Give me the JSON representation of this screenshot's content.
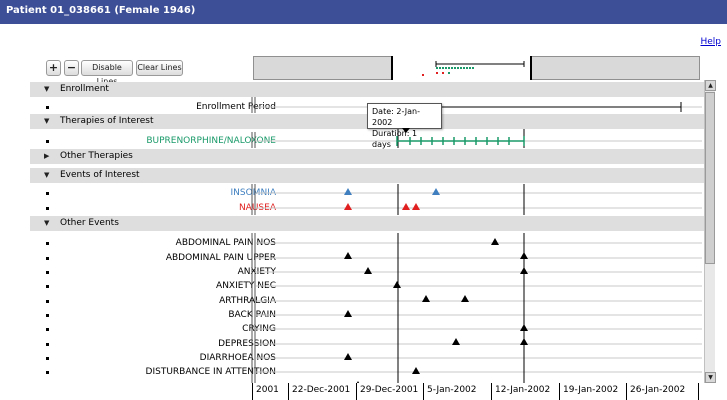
{
  "window": {
    "title": "Patient 01_038661 (Female 1946)"
  },
  "help_label": "Help",
  "toolbar": {
    "zoom_in_label": "+",
    "zoom_out_label": "−",
    "disable_lines_label": "Disable Lines",
    "clear_lines_label": "Clear Lines"
  },
  "tooltip": {
    "date": "Date: 2-Jan-2002",
    "duration": "Duration: 1 days"
  },
  "sections": {
    "enrollment": "Enrollment",
    "therapies": "Therapies of Interest",
    "other_therapies": "Other Therapies",
    "events": "Events of Interest",
    "other_events": "Other Events"
  },
  "rows": {
    "enrollment_period": "Enrollment Period",
    "buprenorphine": "BUPRENORPHINE/NALOXONE",
    "insomnia": "INSOMNIA",
    "nausea": "NAUSEA",
    "other_events": [
      "ABDOMINAL PAIN NOS",
      "ABDOMINAL PAIN UPPER",
      "ANXIETY",
      "ANXIETY NEC",
      "ARTHRALGIA",
      "BACK PAIN",
      "CRYING",
      "DEPRESSION",
      "DIARRHOEA NOS",
      "DISTURBANCE IN ATTENTION"
    ]
  },
  "colors": {
    "title_bg": "#3d4f96",
    "therapy": "#1a9a6a",
    "insomnia": "#3f7fbf",
    "nausea": "#e02020"
  },
  "x_axis_ticks": [
    "2001",
    "22-Dec-2001",
    "29-Dec-2001",
    "5-Jan-2002",
    "12-Jan-2002",
    "19-Jan-2002",
    "26-Jan-2002"
  ]
}
